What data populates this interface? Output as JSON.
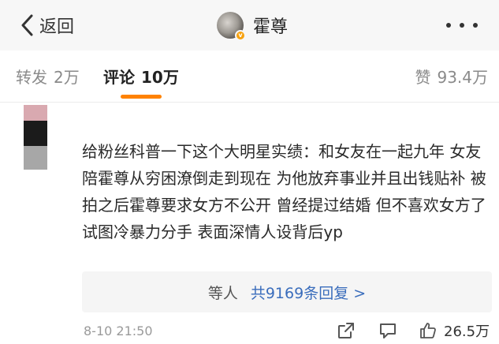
{
  "nav": {
    "back_label": "返回",
    "title": "霍尊",
    "verified_badge": "v"
  },
  "tabs": {
    "repost_label": "转发",
    "repost_count": "2万",
    "comment_label": "评论",
    "comment_count": "10万",
    "likes_label": "赞",
    "likes_count": "93.4万",
    "active": "comment",
    "accent_color": "#ff8200"
  },
  "comment": {
    "text": "给粉丝科普一下这个大明星实绩：和女友在一起九年 女友陪霍尊从穷困潦倒走到现在 为他放弃事业并且出钱贴补 被拍之后霍尊要求女方不公开 曾经提过结婚 但不喜欢女方了 试图冷暴力分手 表面深情人设背后yp",
    "replies_prefix": "等人",
    "replies_link": "共9169条回复 >",
    "timestamp": "8-10 21:50",
    "like_count": "26.5万"
  },
  "icons": [
    "chevron-left-icon",
    "more-dots-icon",
    "share-icon",
    "comment-icon",
    "thumbs-up-icon"
  ]
}
